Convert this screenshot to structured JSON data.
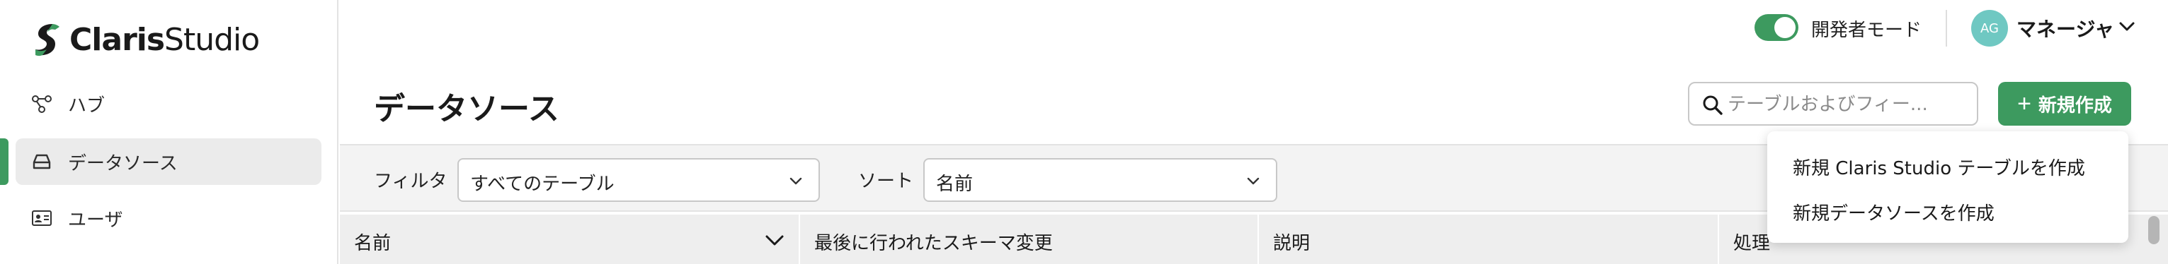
{
  "app": {
    "logo_text_bold": "Claris",
    "logo_text_light": "Studio"
  },
  "sidebar": {
    "items": [
      {
        "label": "ハブ",
        "icon": "hub-icon",
        "active": false
      },
      {
        "label": "データソース",
        "icon": "database-icon",
        "active": true
      },
      {
        "label": "ユーザ",
        "icon": "user-card-icon",
        "active": false
      }
    ]
  },
  "topbar": {
    "dev_mode_label": "開発者モード",
    "dev_mode_on": true,
    "avatar_initials": "AG",
    "user_name": "マネージャ"
  },
  "header": {
    "title": "データソース",
    "search_placeholder": "テーブルおよびフィー...",
    "new_button_label": "新規作成"
  },
  "filters": {
    "filter_label": "フィルタ",
    "filter_value": "すべてのテーブル",
    "sort_label": "ソート",
    "sort_value": "名前"
  },
  "table": {
    "columns": [
      "名前",
      "最後に行われたスキーマ変更",
      "説明",
      "処理"
    ]
  },
  "menu": {
    "items": [
      "新規 Claris Studio テーブルを作成",
      "新規データソースを作成"
    ]
  },
  "colors": {
    "accent": "#3d9a5f",
    "avatar": "#6fc8c2"
  }
}
